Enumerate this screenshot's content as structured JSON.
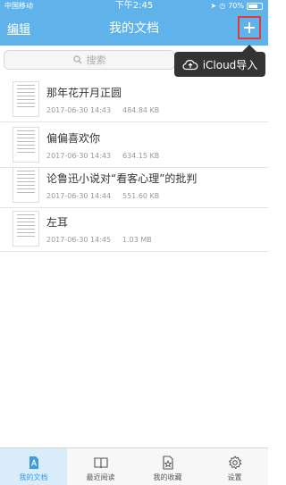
{
  "status_bar": {
    "carrier": "中国移动",
    "time": "下午2:45",
    "battery": "70%",
    "battery_level": 0.7
  },
  "nav": {
    "edit_label": "编辑",
    "title": "我的文档"
  },
  "search": {
    "placeholder": "搜索"
  },
  "popup": {
    "label": "iCloud导入"
  },
  "documents": [
    {
      "name": "那年花开月正圆",
      "date": "2017-06-30 14:43",
      "size": "484.84 KB"
    },
    {
      "name": "偏偏喜欢你",
      "date": "2017-06-30 14:43",
      "size": "634.15 KB"
    },
    {
      "name": "论鲁迅小说对“看客心理”的批判",
      "date": "2017-06-30 14:44",
      "size": "551.60 KB"
    },
    {
      "name": "左耳",
      "date": "2017-06-30 14:45",
      "size": "1.03 MB"
    }
  ],
  "tabs": [
    {
      "label": "我的文档",
      "icon": "document-icon",
      "active": true
    },
    {
      "label": "最近阅读",
      "icon": "book-icon",
      "active": false
    },
    {
      "label": "我的收藏",
      "icon": "star-doc-icon",
      "active": false
    },
    {
      "label": "设置",
      "icon": "gear-icon",
      "active": false
    }
  ],
  "colors": {
    "header": "#5fb3ea",
    "add_highlight": "#e43a3a",
    "active_tab": "#3a9be0"
  }
}
